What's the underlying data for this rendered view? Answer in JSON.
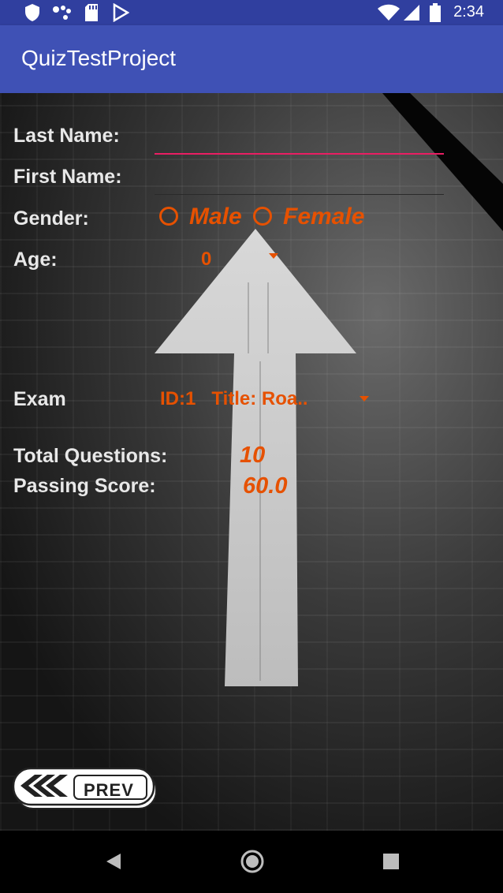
{
  "status_bar": {
    "time": "2:34",
    "left_icons": [
      "shield-icon",
      "share-icon",
      "sd-card-icon",
      "play-store-icon"
    ],
    "right_icons": [
      "wifi-icon",
      "signal-icon",
      "battery-icon"
    ]
  },
  "app_bar": {
    "title": "QuizTestProject",
    "color": "#3f51b5"
  },
  "form": {
    "last_name_label": "Last Name:",
    "last_name_value": "",
    "first_name_label": "First Name:",
    "first_name_value": "",
    "gender_label": "Gender:",
    "gender_options": [
      "Male",
      "Female"
    ],
    "age_label": "Age:",
    "age_value": "0",
    "exam_label": "Exam",
    "exam_value": "ID:1   Title: Roa..",
    "total_questions_label": "Total Questions:",
    "total_questions_value": "10",
    "passing_score_label": "Passing Score:",
    "passing_score_value": "60.0"
  },
  "prev_button": {
    "label": "PREV"
  },
  "nav_bar": {
    "icons": [
      "back-icon",
      "home-icon",
      "recents-icon"
    ]
  },
  "colors": {
    "accent": "#e65100",
    "focus_line": "#e91e63",
    "primary_dark": "#303f9f"
  }
}
